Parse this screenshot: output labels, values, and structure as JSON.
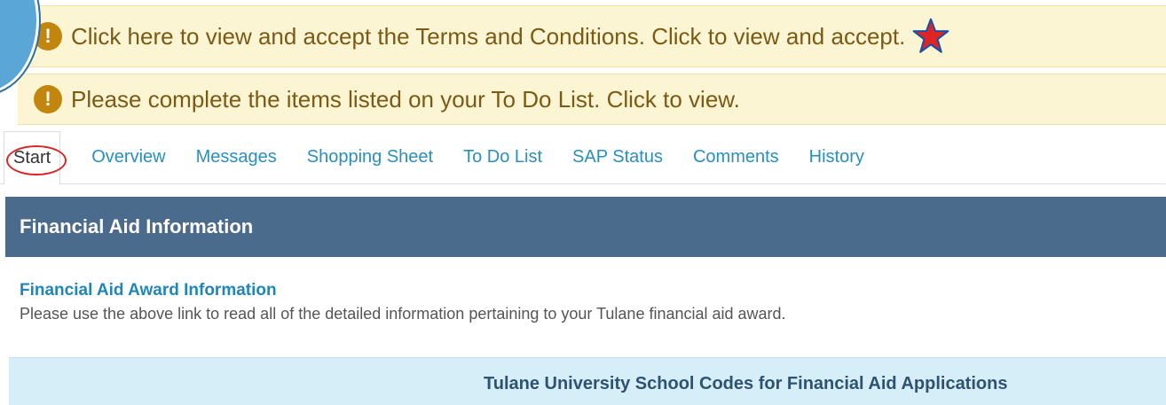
{
  "alerts": [
    {
      "icon": "!",
      "text": "Click here to view and accept the Terms and Conditions. Click to view and accept."
    },
    {
      "icon": "!",
      "text": "Please complete the items listed on your To Do List. Click to view."
    }
  ],
  "tabs": [
    {
      "label": "Start"
    },
    {
      "label": "Overview"
    },
    {
      "label": "Messages"
    },
    {
      "label": "Shopping Sheet"
    },
    {
      "label": "To Do List"
    },
    {
      "label": "SAP Status"
    },
    {
      "label": "Comments"
    },
    {
      "label": "History"
    }
  ],
  "section": {
    "title": "Financial Aid Information"
  },
  "award": {
    "link_label": "Financial Aid Award Information",
    "description": "Please use the above link to read all of the detailed information pertaining to your Tulane financial aid award."
  },
  "codes": {
    "title": "Tulane University School Codes for Financial Aid Applications"
  },
  "colors": {
    "alert_bg": "#fcf5d3",
    "alert_icon": "#c2850e",
    "link_blue": "#2a8fbd",
    "header_bg": "#4a6b8c",
    "codes_bg": "#d6eef8",
    "star_red": "#e02424",
    "oval_red": "#d62828"
  },
  "icons": {
    "alert": "exclamation-circle-icon",
    "star": "star-icon"
  }
}
